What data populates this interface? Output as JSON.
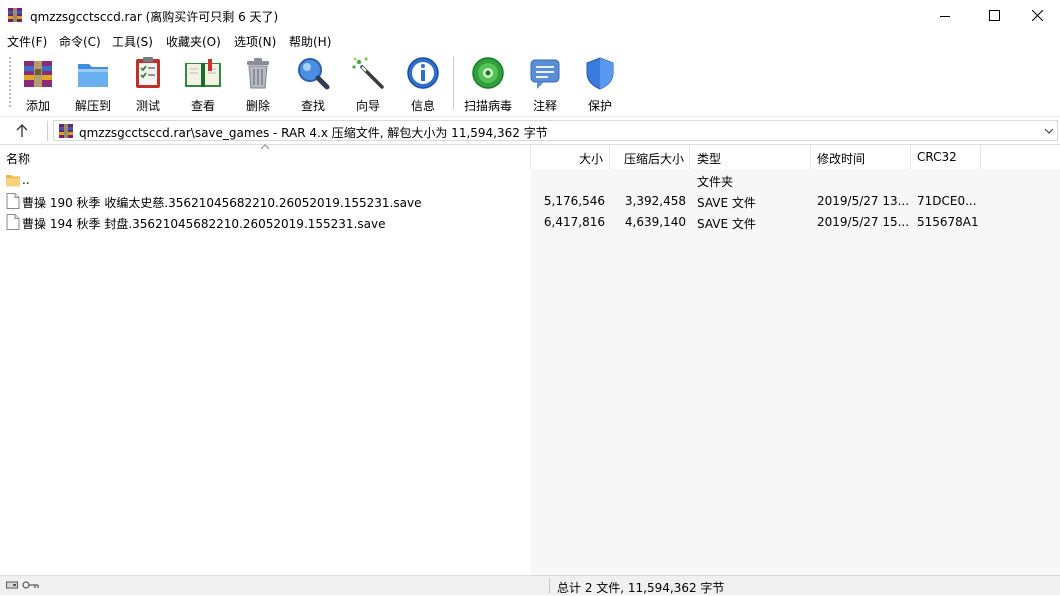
{
  "window": {
    "title": "qmzzsgcctsccd.rar (离购买许可只剩 6 天了)",
    "icon": "winrar-icon"
  },
  "menu": [
    {
      "label": "文件(F)"
    },
    {
      "label": "命令(C)"
    },
    {
      "label": "工具(S)"
    },
    {
      "label": "收藏夹(O)"
    },
    {
      "label": "选项(N)"
    },
    {
      "label": "帮助(H)"
    }
  ],
  "toolbar": [
    {
      "label": "添加",
      "icon": "add-archive-icon"
    },
    {
      "label": "解压到",
      "icon": "extract-folder-icon"
    },
    {
      "label": "测试",
      "icon": "test-icon"
    },
    {
      "label": "查看",
      "icon": "view-book-icon"
    },
    {
      "label": "删除",
      "icon": "trash-icon"
    },
    {
      "label": "查找",
      "icon": "magnifier-icon"
    },
    {
      "label": "向导",
      "icon": "wizard-icon"
    },
    {
      "label": "信息",
      "icon": "info-icon"
    },
    {
      "label": "扫描病毒",
      "icon": "virus-scan-icon"
    },
    {
      "label": "注释",
      "icon": "comment-icon"
    },
    {
      "label": "保护",
      "icon": "shield-icon"
    }
  ],
  "address": {
    "path": "qmzzsgcctsccd.rar\\save_games - RAR 4.x 压缩文件, 解包大小为 11,594,362 字节"
  },
  "columns": {
    "name": "名称",
    "size": "大小",
    "packed": "压缩后大小",
    "type": "类型",
    "modified": "修改时间",
    "crc": "CRC32"
  },
  "files": [
    {
      "name": "..",
      "size": "",
      "packed": "",
      "type": "文件夹",
      "modified": "",
      "crc": "",
      "icon": "folder-icon"
    },
    {
      "name": "曹操 190 秋季 收编太史慈.35621045682210.26052019.155231.save",
      "size": "5,176,546",
      "packed": "3,392,458",
      "type": "SAVE 文件",
      "modified": "2019/5/27 13...",
      "crc": "71DCE0...",
      "icon": "file-icon"
    },
    {
      "name": "曹操 194 秋季 封盘.35621045682210.26052019.155231.save",
      "size": "6,417,816",
      "packed": "4,639,140",
      "type": "SAVE 文件",
      "modified": "2019/5/27 15...",
      "crc": "515678A1",
      "icon": "file-icon"
    }
  ],
  "status": {
    "summary": "总计 2 文件, 11,594,362 字节"
  }
}
